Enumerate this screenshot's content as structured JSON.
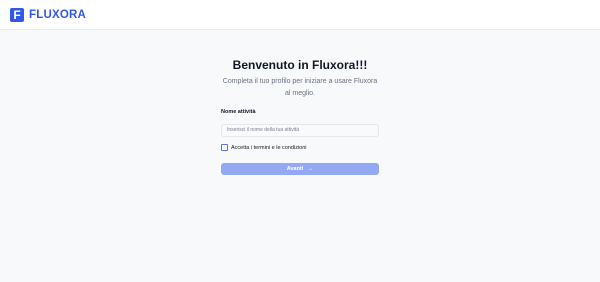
{
  "brand": {
    "name": "FLUXORA",
    "logo_letter": "F",
    "accent_color": "#2f58e8"
  },
  "onboarding": {
    "title": "Benvenuto in Fluxora!!!",
    "subtitle": "Completa il tuo profilo per iniziare a usare Fluxora al meglio.",
    "business_name": {
      "label": "Nome attività",
      "value": "",
      "placeholder": "Inserisci il nome della tua attività"
    },
    "terms": {
      "label": "Accetta i termini e le condizioni",
      "checked": false
    },
    "next_button": {
      "label": "Avanti",
      "icon": "arrow-right-icon",
      "disabled": true
    }
  }
}
